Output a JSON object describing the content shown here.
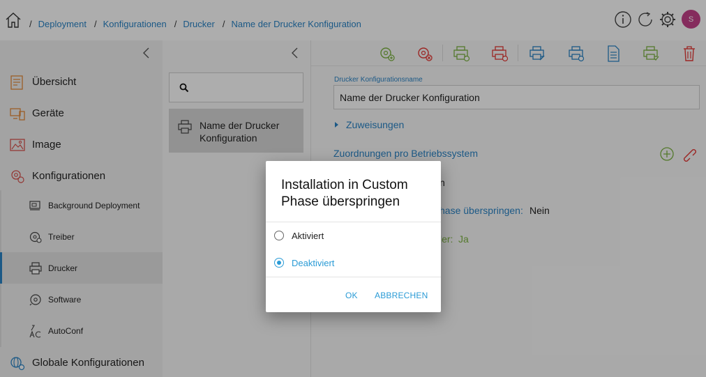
{
  "breadcrumb": {
    "separator": "/",
    "items": [
      "Deployment",
      "Konfigurationen",
      "Drucker",
      "Name der Drucker Konfiguration"
    ]
  },
  "header": {
    "avatar_initial": "S"
  },
  "nav": {
    "items": [
      {
        "label": "Übersicht",
        "icon": "overview-icon"
      },
      {
        "label": "Geräte",
        "icon": "devices-icon"
      },
      {
        "label": "Image",
        "icon": "image-icon"
      },
      {
        "label": "Konfigurationen",
        "icon": "configurations-icon"
      }
    ],
    "sub_items": [
      {
        "label": "Background Deployment",
        "icon": "background-deployment-icon"
      },
      {
        "label": "Treiber",
        "icon": "driver-icon"
      },
      {
        "label": "Drucker",
        "icon": "printer-icon",
        "active": true
      },
      {
        "label": "Software",
        "icon": "software-icon"
      },
      {
        "label": "AutoConf",
        "icon": "autoconf-icon"
      }
    ],
    "bottom": {
      "label": "Globale Konfigurationen",
      "icon": "global-config-icon"
    }
  },
  "list": {
    "search_placeholder": "",
    "items": [
      {
        "label": "Name der Drucker Konfiguration"
      }
    ]
  },
  "form": {
    "name_label": "Drucker Konfigurationsname",
    "name_value": "Name der Drucker Konfiguration",
    "assignments_label": "Zuweisungen",
    "os_section_title": "Zuordnungen pro Betriebssystem",
    "row1_visible_tail": "n",
    "row2_label_tail": "hase überspringen:",
    "row2_value": "Nein",
    "row3_label_tail": "ler:",
    "row3_value": "Ja"
  },
  "dialog": {
    "title": "Installation in Custom Phase überspringen",
    "options": [
      {
        "label": "Aktiviert",
        "checked": false
      },
      {
        "label": "Deaktiviert",
        "checked": true
      }
    ],
    "ok_label": "OK",
    "cancel_label": "ABBRECHEN"
  },
  "colors": {
    "accent": "#2a84c6",
    "dialog_accent": "#2a9bd6",
    "avatar": "#c5428a",
    "success_green": "#7cb342",
    "danger_red": "#e53935"
  }
}
